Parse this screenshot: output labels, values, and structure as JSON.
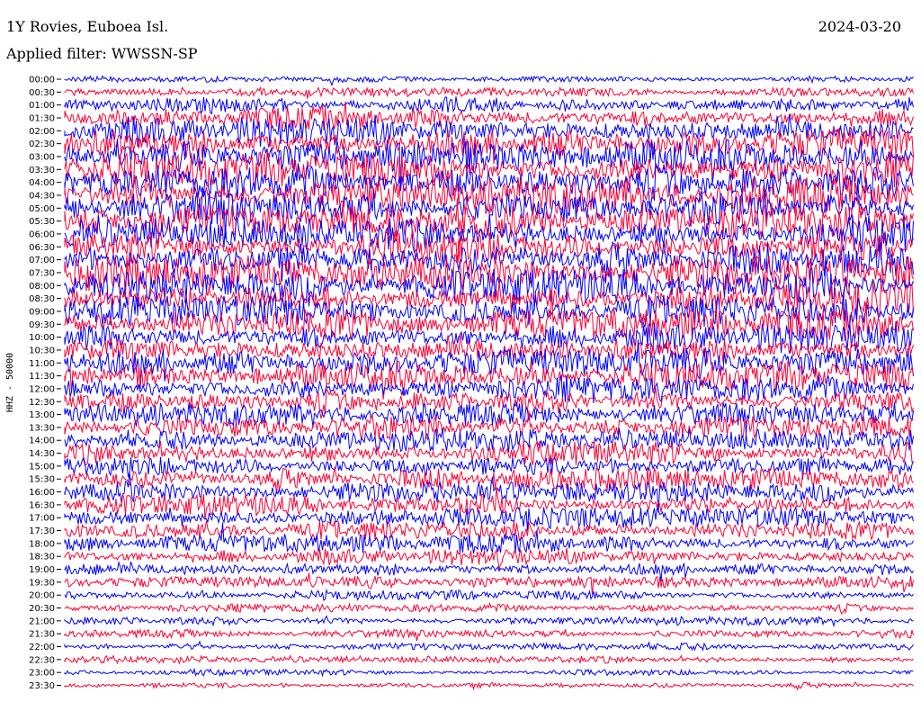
{
  "header": {
    "station": "1Y Rovies, Euboea Isl.",
    "date": "2024-03-20",
    "filter": "Applied filter: WWSSN-SP"
  },
  "chart_data": {
    "type": "line",
    "title": "1Y Rovies, Euboea Isl.",
    "subtitle": "Applied filter: WWSSN-SP",
    "ylabel": "HHZ - 50000",
    "row_labels": [
      "00:00",
      "00:30",
      "01:00",
      "01:30",
      "02:00",
      "02:30",
      "03:00",
      "03:30",
      "04:00",
      "04:30",
      "05:00",
      "05:30",
      "06:00",
      "06:30",
      "07:00",
      "07:30",
      "08:00",
      "08:30",
      "09:00",
      "09:30",
      "10:00",
      "10:30",
      "11:00",
      "11:30",
      "12:00",
      "12:30",
      "13:00",
      "13:30",
      "14:00",
      "14:30",
      "15:00",
      "15:30",
      "16:00",
      "16:30",
      "17:00",
      "17:30",
      "18:00",
      "18:30",
      "19:00",
      "19:30",
      "20:00",
      "20:30",
      "21:00",
      "21:30",
      "22:00",
      "22:30",
      "23:00",
      "23:30"
    ],
    "series_colors": [
      "#0000ff",
      "#ff0033"
    ],
    "amplitude": [
      0.25,
      0.35,
      0.7,
      1.0,
      1.3,
      1.4,
      1.4,
      1.45,
      1.5,
      1.5,
      1.45,
      1.45,
      1.45,
      1.4,
      1.45,
      1.45,
      1.4,
      1.35,
      1.35,
      1.35,
      1.3,
      1.3,
      1.25,
      1.2,
      1.1,
      1.0,
      0.95,
      1.0,
      0.95,
      0.95,
      0.9,
      0.9,
      0.85,
      0.85,
      0.85,
      0.8,
      0.8,
      0.7,
      0.6,
      0.5,
      0.4,
      0.35,
      0.35,
      0.35,
      0.3,
      0.3,
      0.25,
      0.25
    ],
    "grid": false,
    "legend": "none"
  }
}
